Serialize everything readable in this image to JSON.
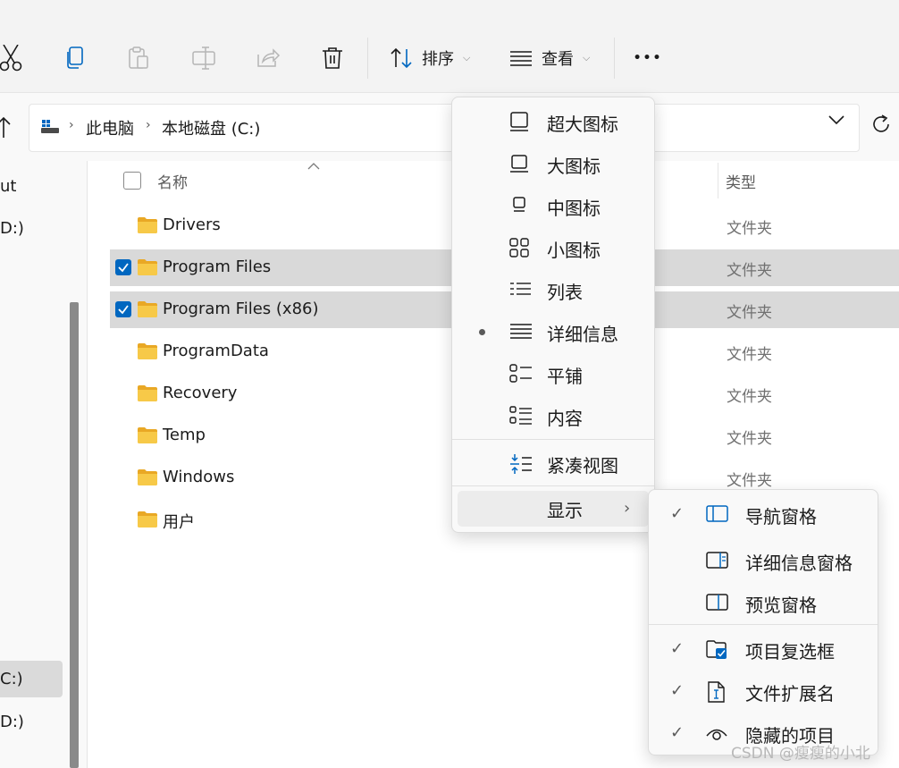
{
  "toolbar": {
    "sort_label": "排序",
    "view_label": "查看",
    "more_label": "•••"
  },
  "address": {
    "crumbs": [
      "此电脑",
      "本地磁盘 (C:)"
    ]
  },
  "nav": {
    "items": [
      "ut",
      "D:)",
      "C:)",
      "D:)"
    ]
  },
  "columns": {
    "name": "名称",
    "type": "类型"
  },
  "files": [
    {
      "name": "Drivers",
      "type": "文件夹",
      "selected": false
    },
    {
      "name": "Program Files",
      "type": "文件夹",
      "selected": true
    },
    {
      "name": "Program Files (x86)",
      "type": "文件夹",
      "selected": true
    },
    {
      "name": "ProgramData",
      "type": "文件夹",
      "selected": false
    },
    {
      "name": "Recovery",
      "type": "文件夹",
      "selected": false
    },
    {
      "name": "Temp",
      "type": "文件夹",
      "selected": false
    },
    {
      "name": "Windows",
      "type": "文件夹",
      "selected": false
    },
    {
      "name": "用户",
      "type": "",
      "selected": false
    }
  ],
  "view_menu": {
    "items": [
      "超大图标",
      "大图标",
      "中图标",
      "小图标",
      "列表",
      "详细信息",
      "平铺",
      "内容"
    ],
    "active": "详细信息",
    "compact": "紧凑视图",
    "show": "显示"
  },
  "show_menu": {
    "items": [
      {
        "label": "导航窗格",
        "checked": true
      },
      {
        "label": "详细信息窗格",
        "checked": false
      },
      {
        "label": "预览窗格",
        "checked": false
      },
      {
        "label": "项目复选框",
        "checked": true
      },
      {
        "label": "文件扩展名",
        "checked": true
      },
      {
        "label": "隐藏的项目",
        "checked": true
      }
    ],
    "check_glyph": "✓"
  },
  "colors": {
    "accent": "#0067c0",
    "folder": "#f7c948",
    "selection": "#d9d9d9"
  },
  "watermark": "CSDN @瘦瘦的小北"
}
